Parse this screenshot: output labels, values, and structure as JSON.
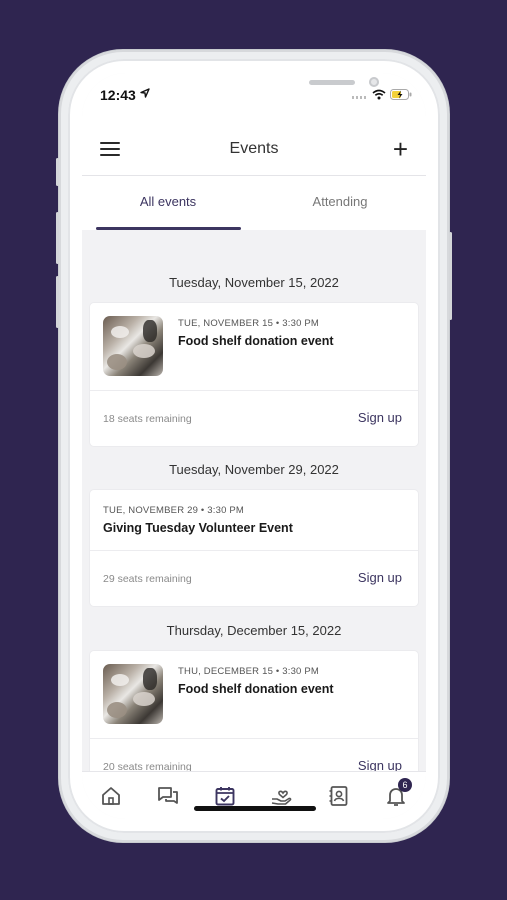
{
  "status_bar": {
    "time": "12:43"
  },
  "header": {
    "title": "Events",
    "add_label": "+"
  },
  "tabs": [
    {
      "label": "All events",
      "active": true
    },
    {
      "label": "Attending",
      "active": false
    }
  ],
  "sections": [
    {
      "date": "Tuesday, November 15, 2022",
      "event": {
        "meta": "TUE, NOVEMBER 15 • 3:30 PM",
        "title": "Food shelf donation event",
        "has_image": true,
        "seats": "18 seats remaining",
        "action": "Sign up"
      }
    },
    {
      "date": "Tuesday, November 29, 2022",
      "event": {
        "meta": "TUE, NOVEMBER 29 • 3:30 PM",
        "title": "Giving Tuesday Volunteer Event",
        "has_image": false,
        "seats": "29 seats remaining",
        "action": "Sign up"
      }
    },
    {
      "date": "Thursday, December 15, 2022",
      "event": {
        "meta": "THU, DECEMBER 15 • 3:30 PM",
        "title": "Food shelf donation event",
        "has_image": true,
        "seats": "20 seats remaining",
        "action": "Sign up"
      }
    }
  ],
  "bottom_nav": {
    "items": [
      "home-icon",
      "chat-icon",
      "calendar-check-icon",
      "donate-heart-icon",
      "contacts-icon",
      "bell-icon"
    ],
    "notification_count": "6"
  },
  "colors": {
    "background": "#2f2550",
    "accent": "#3c3560"
  }
}
